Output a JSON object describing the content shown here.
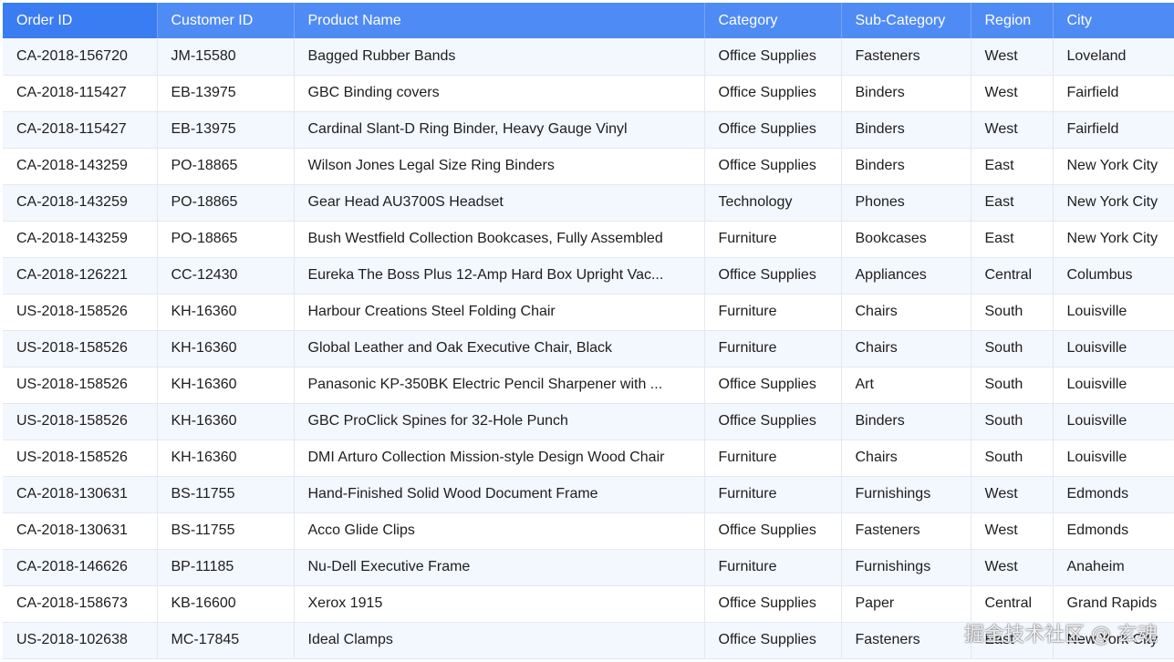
{
  "colors": {
    "header_bg": "#4f8bf5",
    "header_first_bg": "#3a7cf2",
    "header_text": "#ffffff",
    "row_alt_bg": "#f3f7fe",
    "row_bg": "#ffffff"
  },
  "table": {
    "columns": [
      "Order ID",
      "Customer ID",
      "Product Name",
      "Category",
      "Sub-Category",
      "Region",
      "City"
    ],
    "rows": [
      [
        "CA-2018-156720",
        "JM-15580",
        "Bagged Rubber Bands",
        "Office Supplies",
        "Fasteners",
        "West",
        "Loveland"
      ],
      [
        "CA-2018-115427",
        "EB-13975",
        "GBC Binding covers",
        "Office Supplies",
        "Binders",
        "West",
        "Fairfield"
      ],
      [
        "CA-2018-115427",
        "EB-13975",
        "Cardinal Slant-D Ring Binder, Heavy Gauge Vinyl",
        "Office Supplies",
        "Binders",
        "West",
        "Fairfield"
      ],
      [
        "CA-2018-143259",
        "PO-18865",
        "Wilson Jones Legal Size Ring Binders",
        "Office Supplies",
        "Binders",
        "East",
        "New York City"
      ],
      [
        "CA-2018-143259",
        "PO-18865",
        "Gear Head AU3700S Headset",
        "Technology",
        "Phones",
        "East",
        "New York City"
      ],
      [
        "CA-2018-143259",
        "PO-18865",
        "Bush Westfield Collection Bookcases, Fully Assembled",
        "Furniture",
        "Bookcases",
        "East",
        "New York City"
      ],
      [
        "CA-2018-126221",
        "CC-12430",
        "Eureka The Boss Plus 12-Amp Hard Box Upright Vac...",
        "Office Supplies",
        "Appliances",
        "Central",
        "Columbus"
      ],
      [
        "US-2018-158526",
        "KH-16360",
        "Harbour Creations Steel Folding Chair",
        "Furniture",
        "Chairs",
        "South",
        "Louisville"
      ],
      [
        "US-2018-158526",
        "KH-16360",
        "Global Leather and Oak Executive Chair, Black",
        "Furniture",
        "Chairs",
        "South",
        "Louisville"
      ],
      [
        "US-2018-158526",
        "KH-16360",
        "Panasonic KP-350BK Electric Pencil Sharpener with ...",
        "Office Supplies",
        "Art",
        "South",
        "Louisville"
      ],
      [
        "US-2018-158526",
        "KH-16360",
        "GBC ProClick Spines for 32-Hole Punch",
        "Office Supplies",
        "Binders",
        "South",
        "Louisville"
      ],
      [
        "US-2018-158526",
        "KH-16360",
        "DMI Arturo Collection Mission-style Design Wood Chair",
        "Furniture",
        "Chairs",
        "South",
        "Louisville"
      ],
      [
        "CA-2018-130631",
        "BS-11755",
        "Hand-Finished Solid Wood Document Frame",
        "Furniture",
        "Furnishings",
        "West",
        "Edmonds"
      ],
      [
        "CA-2018-130631",
        "BS-11755",
        "Acco Glide Clips",
        "Office Supplies",
        "Fasteners",
        "West",
        "Edmonds"
      ],
      [
        "CA-2018-146626",
        "BP-11185",
        "Nu-Dell Executive Frame",
        "Furniture",
        "Furnishings",
        "West",
        "Anaheim"
      ],
      [
        "CA-2018-158673",
        "KB-16600",
        "Xerox 1915",
        "Office Supplies",
        "Paper",
        "Central",
        "Grand Rapids"
      ],
      [
        "US-2018-102638",
        "MC-17845",
        "Ideal Clamps",
        "Office Supplies",
        "Fasteners",
        "East",
        "New York City"
      ]
    ]
  },
  "watermark": "掘金技术社区 @ 玄魂"
}
